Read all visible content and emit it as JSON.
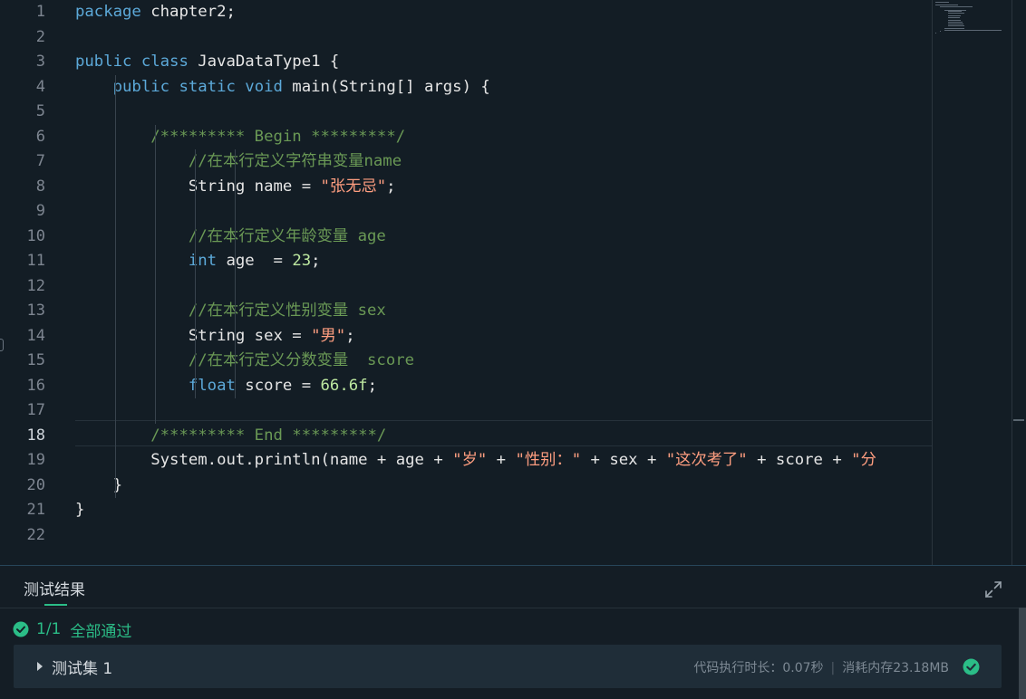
{
  "editor": {
    "line_numbers": [
      "1",
      "2",
      "3",
      "4",
      "5",
      "6",
      "7",
      "8",
      "9",
      "10",
      "11",
      "12",
      "13",
      "14",
      "15",
      "16",
      "17",
      "18",
      "19",
      "20",
      "21",
      "22"
    ],
    "active_line": "18",
    "lines": [
      [
        {
          "t": "kw",
          "v": "package"
        },
        {
          "t": "pl",
          "v": " chapter2;"
        }
      ],
      [],
      [
        {
          "t": "kw",
          "v": "public class"
        },
        {
          "t": "pl",
          "v": " JavaDataType1 {"
        }
      ],
      [
        {
          "t": "pl",
          "v": "    "
        },
        {
          "t": "kw",
          "v": "public static void"
        },
        {
          "t": "pl",
          "v": " main(String[] args) {"
        }
      ],
      [],
      [
        {
          "t": "pl",
          "v": "        "
        },
        {
          "t": "cm",
          "v": "/********* Begin *********/"
        }
      ],
      [
        {
          "t": "pl",
          "v": "            "
        },
        {
          "t": "cm",
          "v": "//在本行定义字符串变量name"
        }
      ],
      [
        {
          "t": "pl",
          "v": "            String name = "
        },
        {
          "t": "str",
          "v": "\"张无忌\""
        },
        {
          "t": "pl",
          "v": ";"
        }
      ],
      [],
      [
        {
          "t": "pl",
          "v": "            "
        },
        {
          "t": "cm",
          "v": "//在本行定义年龄变量 age"
        }
      ],
      [
        {
          "t": "pl",
          "v": "            "
        },
        {
          "t": "kw",
          "v": "int"
        },
        {
          "t": "pl",
          "v": " age  = "
        },
        {
          "t": "num",
          "v": "23"
        },
        {
          "t": "pl",
          "v": ";"
        }
      ],
      [],
      [
        {
          "t": "pl",
          "v": "            "
        },
        {
          "t": "cm",
          "v": "//在本行定义性别变量 sex"
        }
      ],
      [
        {
          "t": "pl",
          "v": "            String sex = "
        },
        {
          "t": "str",
          "v": "\"男\""
        },
        {
          "t": "pl",
          "v": ";"
        }
      ],
      [
        {
          "t": "pl",
          "v": "            "
        },
        {
          "t": "cm",
          "v": "//在本行定义分数变量  score"
        }
      ],
      [
        {
          "t": "pl",
          "v": "            "
        },
        {
          "t": "kw",
          "v": "float"
        },
        {
          "t": "pl",
          "v": " score = "
        },
        {
          "t": "num",
          "v": "66.6f"
        },
        {
          "t": "pl",
          "v": ";"
        }
      ],
      [],
      [
        {
          "t": "pl",
          "v": "        "
        },
        {
          "t": "cm",
          "v": "/********* End *********/"
        }
      ],
      [
        {
          "t": "pl",
          "v": "        System.out.println(name + age + "
        },
        {
          "t": "str",
          "v": "\"岁\""
        },
        {
          "t": "pl",
          "v": " + "
        },
        {
          "t": "str",
          "v": "\"性别：\""
        },
        {
          "t": "pl",
          "v": " + sex + "
        },
        {
          "t": "str",
          "v": "\"这次考了\""
        },
        {
          "t": "pl",
          "v": " + score + "
        },
        {
          "t": "str",
          "v": "\"分"
        }
      ],
      [
        {
          "t": "pl",
          "v": "    }"
        }
      ],
      [
        {
          "t": "pl",
          "v": "}"
        }
      ],
      []
    ]
  },
  "panel": {
    "title": "测试结果",
    "result_count": "1/1",
    "result_status": "全部通过",
    "testset": {
      "label": "测试集 1",
      "duration": "代码执行时长：0.07秒",
      "separator": "|",
      "memory": "消耗内存23.18MB"
    },
    "colors": {
      "pass": "#2bbd87",
      "accent_border": "#274559"
    },
    "icons": {
      "expand": "expand-icon",
      "pass": "check-circle-icon",
      "caret": "caret-right-icon"
    }
  }
}
